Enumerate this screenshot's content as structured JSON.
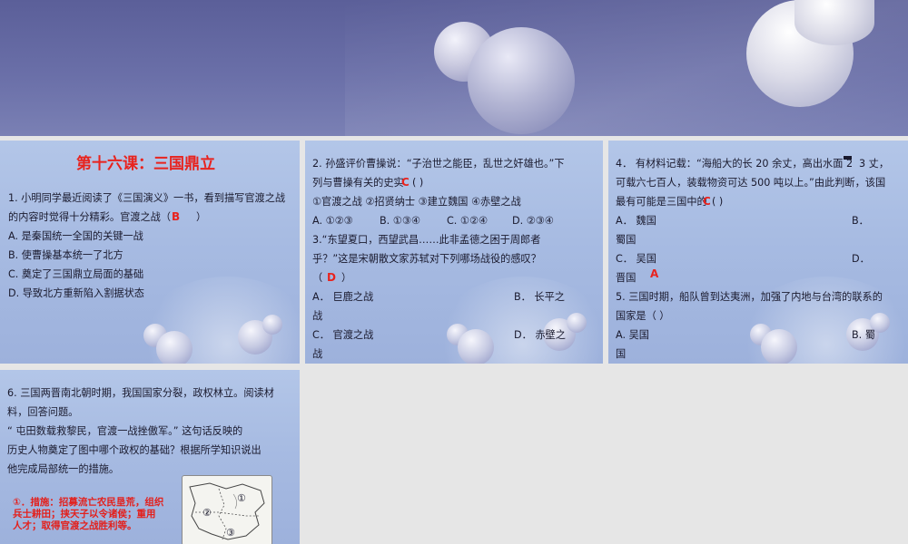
{
  "slide1": {
    "title": "第十六课：三国鼎立",
    "q1_line1": "1. 小明同学最近阅读了《三国演义》一书，看到描写官渡之战",
    "q1_line2": "的内容时觉得十分精彩。官渡之战（",
    "q1_close": "）",
    "answer": "B",
    "options": [
      "A. 是秦国统一全国的关键一战",
      "B. 使曹操基本统一了北方",
      "C. 奠定了三国鼎立局面的基础",
      "D. 导致北方重新陷入割据状态"
    ]
  },
  "slide2": {
    "q2_line1": "2.  孙盛评价曹操说：“子治世之能臣，乱世之奸雄也。”下",
    "q2_line2": "列与曹操有关的史实",
    "q2_answer": "C",
    "q2_line2_end": "(        )",
    "q2_items": "①官渡之战    ②招贤纳士    ③建立魏国    ④赤壁之战",
    "q2_options": [
      "A.  ①②③",
      "B.  ①③④",
      "C.  ①②④",
      "D.  ②③④"
    ],
    "q3_line1": "3.“东望夏口，西望武昌……此非孟德之困于周郎者",
    "q3_line2": "乎？”这是宋朝散文家苏轼对下列哪场战役的感叹？",
    "q3_open": "（",
    "q3_answer": "D",
    "q3_close": "）",
    "q3_a": "A．   巨鹿之战",
    "q3_b": "B．   长平之",
    "q3_b_wrap": "战",
    "q3_c": "C．   官渡之战",
    "q3_d": "D．   赤壁之",
    "q3_d_wrap": "战"
  },
  "slide3": {
    "q4_line1": "4．   有材料记载：“海船大的长 20 余丈，高出水面 2",
    "q4_line1_end": "3 丈，",
    "q4_line2": "可载六七百人，装载物资可达 500 吨以上。”由此判断，该国",
    "q4_line3": "最有可能是三国中的",
    "q4_answer": "C",
    "q4_line3_end": "(        )",
    "q4_a": "A．   魏国",
    "q4_b": "B．",
    "q4_b_wrap": "蜀国",
    "q4_c": "C．   吴国",
    "q4_d": "D．",
    "q4_d_wrap": "晋国",
    "q5_answer": "A",
    "q5_line1": "5.  三国时期，船队曾到达夷洲，加强了内地与台湾的联系的",
    "q5_line2": "国家是（             ）",
    "q5_a": "A.  吴国",
    "q5_b": "B.  蜀",
    "q5_b_wrap": "国"
  },
  "slide4": {
    "q6_line1": "6.  三国两晋南北朝时期，我国国家分裂，政权林立。阅读材",
    "q6_line2": "料，回答问题。",
    "q6_line3": "“ 屯田数载救黎民，官渡一战挫傲军。”   这句话反映的",
    "q6_line4": "历史人物奠定了图中哪个政权的基础？根据所学知识说出",
    "q6_line5": "他完成局部统一的措施。",
    "answer_line1": "①．措施：招募流亡农民垦荒，组织",
    "answer_line2": "兵士耕田；挟天子以令诸侯；重用",
    "answer_line3": "人才；取得官渡之战胜利等。",
    "map_labels": [
      "①",
      "②",
      "③"
    ]
  }
}
